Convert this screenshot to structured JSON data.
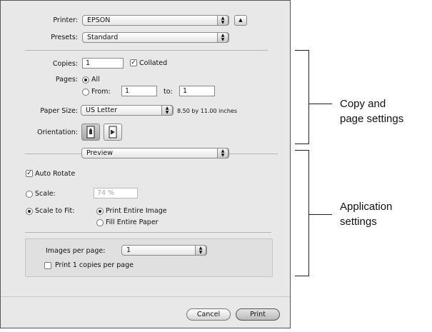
{
  "printer": {
    "label": "Printer:",
    "value": "EPSON"
  },
  "presets": {
    "label": "Presets:",
    "value": "Standard"
  },
  "copies": {
    "label": "Copies:",
    "value": "1",
    "collated_label": "Collated",
    "collated_checked": true
  },
  "pages": {
    "label": "Pages:",
    "all_label": "All",
    "from_label": "From:",
    "from_value": "1",
    "to_label": "to:",
    "to_value": "1"
  },
  "paper_size": {
    "label": "Paper Size:",
    "value": "US Letter",
    "dimensions": "8.50 by 11.00 inches"
  },
  "orientation": {
    "label": "Orientation:"
  },
  "panel_popup": {
    "value": "Preview"
  },
  "auto_rotate": {
    "label": "Auto Rotate",
    "checked": true
  },
  "scale": {
    "label": "Scale:",
    "value": "74 %"
  },
  "scale_to_fit": {
    "label": "Scale to Fit:",
    "print_entire_label": "Print Entire Image",
    "fill_entire_label": "Fill Entire Paper"
  },
  "images_per_page": {
    "label": "Images per page:",
    "value": "1"
  },
  "print_copies": {
    "label": "Print 1 copies per page"
  },
  "buttons": {
    "cancel": "Cancel",
    "print": "Print"
  },
  "callouts": {
    "copy_page_line1": "Copy and",
    "copy_page_line2": "page settings",
    "application_line1": "Application",
    "application_line2": "settings"
  },
  "icons": {
    "popup_arrows": "up-down-arrows-icon",
    "disclosure": "disclosure-triangle-icon",
    "portrait": "portrait-orientation-icon",
    "landscape": "landscape-orientation-icon"
  }
}
